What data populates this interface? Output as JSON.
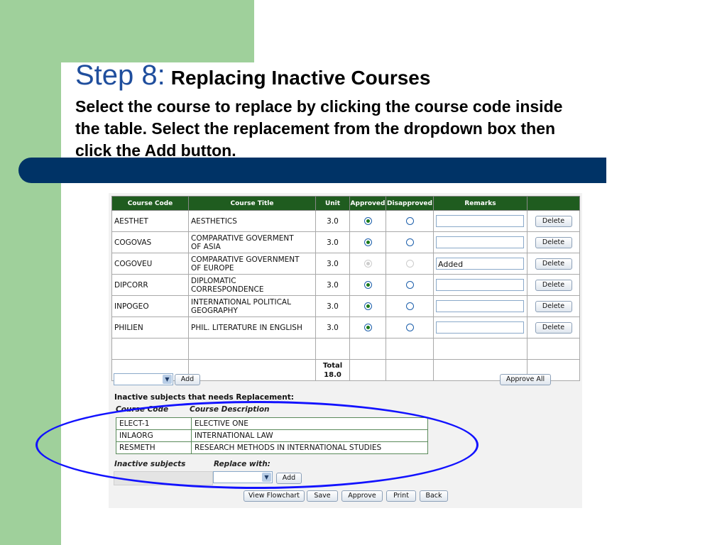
{
  "slide": {
    "step_label": "Step 8:",
    "title": "Replacing Inactive Courses",
    "subtitle_lines": [
      "Select the course to replace by clicking the course code inside",
      "the table. Select the replacement from the dropdown box then",
      "click the Add button."
    ]
  },
  "table": {
    "headers": [
      "Course Code",
      "Course Title",
      "Unit",
      "Approved",
      "Disapproved",
      "Remarks",
      ""
    ],
    "rows": [
      {
        "code": "AESTHET",
        "title_lines": [
          "AESTHETICS"
        ],
        "unit": "3.0",
        "approved": true,
        "disabled": false,
        "remark": ""
      },
      {
        "code": "COGOVAS",
        "title_lines": [
          "COMPARATIVE GOVERMENT",
          "OF ASIA"
        ],
        "unit": "3.0",
        "approved": true,
        "disabled": false,
        "remark": ""
      },
      {
        "code": "COGOVEU",
        "title_lines": [
          "COMPARATIVE GOVERNMENT",
          "OF EUROPE"
        ],
        "unit": "3.0",
        "approved": true,
        "disabled": true,
        "remark": "Added"
      },
      {
        "code": "DIPCORR",
        "title_lines": [
          "DIPLOMATIC",
          "CORRESPONDENCE"
        ],
        "unit": "3.0",
        "approved": true,
        "disabled": false,
        "remark": ""
      },
      {
        "code": "INPOGEO",
        "title_lines": [
          "INTERNATIONAL POLITICAL",
          "GEOGRAPHY"
        ],
        "unit": "3.0",
        "approved": true,
        "disabled": false,
        "remark": ""
      },
      {
        "code": "PHILIEN",
        "title_lines": [
          "PHIL. LITERATURE IN ENGLISH"
        ],
        "unit": "3.0",
        "approved": true,
        "disabled": false,
        "remark": ""
      }
    ],
    "delete_label": "Delete",
    "total_label": "Total",
    "total_value": "18.0"
  },
  "controls": {
    "add_label": "Add",
    "approve_all_label": "Approve All"
  },
  "inactive": {
    "heading": "Inactive subjects that needs Replacement:",
    "col_code": "Course Code",
    "col_desc": "Course Description",
    "rows": [
      {
        "code": "ELECT-1",
        "desc": "ELECTIVE ONE"
      },
      {
        "code": "INLAORG",
        "desc": "INTERNATIONAL LAW"
      },
      {
        "code": "RESMETH",
        "desc": "RESEARCH METHODS IN INTERNATIONAL STUDIES"
      }
    ],
    "inactive_subjects_label": "Inactive subjects",
    "replace_with_label": "Replace with:",
    "add_label": "Add"
  },
  "footer_buttons": [
    "View Flowchart",
    "Save",
    "Approve",
    "Print",
    "Back"
  ],
  "colors": {
    "green": "#9fd09b",
    "navy": "#003366",
    "step_blue": "#1f4e9d",
    "header_green": "#1f5c1f",
    "ellipse": "#1212ff"
  }
}
